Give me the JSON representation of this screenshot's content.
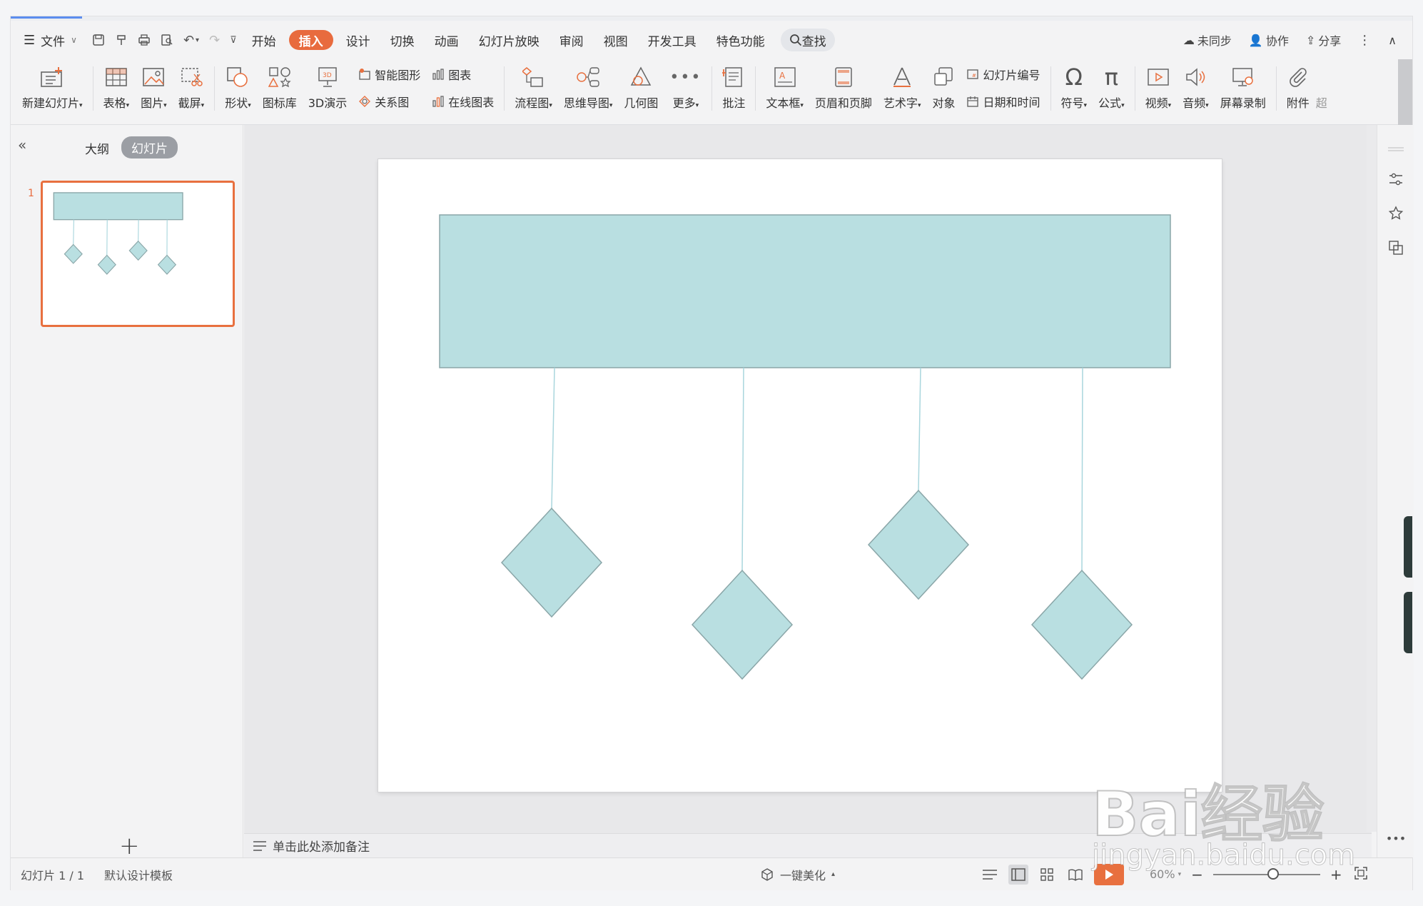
{
  "menu": {
    "file": "文件",
    "tabs": [
      "开始",
      "插入",
      "设计",
      "切换",
      "动画",
      "幻灯片放映",
      "审阅",
      "视图",
      "开发工具",
      "特色功能"
    ],
    "active_tab": "插入",
    "search": "查找",
    "right": {
      "sync": "未同步",
      "collab": "协作",
      "share": "分享"
    }
  },
  "ribbon": {
    "new_slide": "新建幻灯片",
    "table": "表格",
    "picture": "图片",
    "screenshot": "截屏",
    "shape": "形状",
    "icon_lib": "图标库",
    "demo3d": "3D演示",
    "smart_art": "智能图形",
    "chart": "图表",
    "relation": "关系图",
    "online_chart": "在线图表",
    "flowchart": "流程图",
    "mindmap": "思维导图",
    "geometry": "几何图",
    "more": "更多",
    "comment": "批注",
    "textbox": "文本框",
    "header_footer": "页眉和页脚",
    "wordart": "艺术字",
    "object": "对象",
    "slide_number": "幻灯片编号",
    "datetime": "日期和时间",
    "symbol": "符号",
    "formula": "公式",
    "video": "视频",
    "audio": "音频",
    "screen_record": "屏幕录制",
    "attachment": "附件",
    "cut_label": "超"
  },
  "left_panel": {
    "outline": "大纲",
    "slides": "幻灯片",
    "slide_number": "1"
  },
  "notes": {
    "placeholder": "单击此处添加备注"
  },
  "status": {
    "slide_info": "幻灯片 1 / 1",
    "template": "默认设计模板",
    "beautify": "一键美化",
    "zoom": "60%"
  },
  "watermark": {
    "logo": "Bai经验",
    "url": "jingyan.baidu.com"
  },
  "colors": {
    "accent": "#e86b3e",
    "shape_fill": "#b9dfe1",
    "shape_stroke": "#8aa6a8",
    "connector": "#a9d6dd"
  }
}
